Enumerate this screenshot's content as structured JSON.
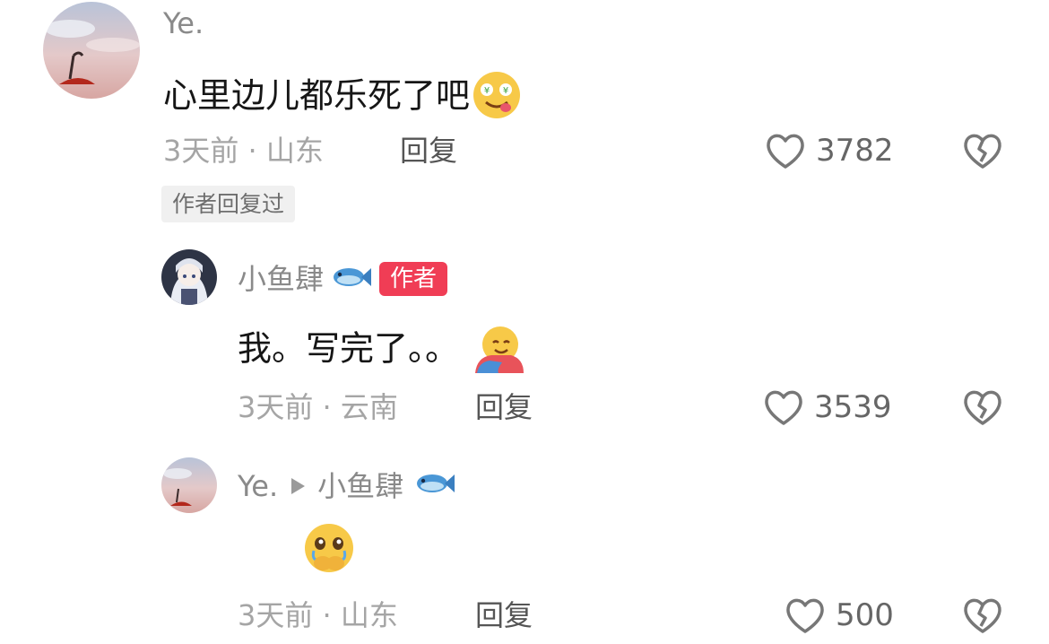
{
  "icons": {
    "like": "heart-icon",
    "dislike": "broken-heart-icon",
    "fish": "fish-emoji-icon",
    "arrow": "play-triangle-icon"
  },
  "colors": {
    "author_badge": "#f03d55",
    "secondary_text": "#a5a5a5",
    "username_text": "#8a8a8a"
  },
  "comments": [
    {
      "username": "Ye.",
      "text": "心里边儿都乐死了吧",
      "emoji": "money-face-emoji",
      "time_location": "3天前 · 山东",
      "reply_label": "回复",
      "likes": "3782",
      "author_replied_chip": "作者回复过"
    },
    {
      "username": "小鱼肆",
      "author_badge": "作者",
      "text": "我。写完了。。",
      "emoji": "hugging-face-emoji",
      "time_location": "3天前 · 云南",
      "reply_label": "回复",
      "likes": "3539"
    },
    {
      "username": "Ye.",
      "reply_to": "小鱼肆",
      "emoji": "holding-back-tears-emoji",
      "time_location": "3天前 · 山东",
      "reply_label": "回复",
      "likes": "500"
    }
  ]
}
